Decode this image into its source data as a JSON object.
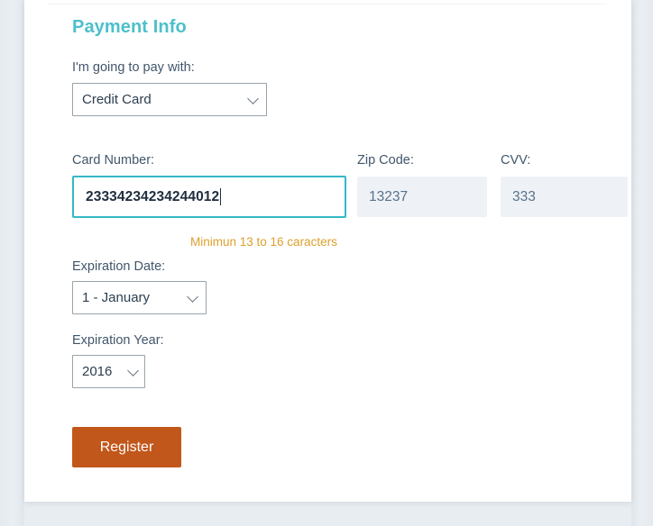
{
  "section": {
    "title": "Payment Info"
  },
  "pay_with": {
    "label": "I'm going to pay with:",
    "selected": "Credit Card",
    "options": [
      "Credit Card"
    ]
  },
  "card_number": {
    "label": "Card Number:",
    "value": "23334234234244012",
    "validation": "Minimun 13 to 16 caracters"
  },
  "zip_code": {
    "label": "Zip Code:",
    "value": "13237"
  },
  "cvv": {
    "label": "CVV:",
    "value": "333"
  },
  "expiration_date": {
    "label": "Expiration Date:",
    "selected": "1 - January",
    "options": [
      "1 - January"
    ]
  },
  "expiration_year": {
    "label": "Expiration Year:",
    "selected": "2016",
    "options": [
      "2016"
    ]
  },
  "actions": {
    "register_label": "Register"
  },
  "colors": {
    "heading_teal": "#4cc0ca",
    "focus_border_teal": "#35b8c6",
    "validation_orange": "#dda02e",
    "register_button": "#c2571b",
    "label_text": "#41566b",
    "disabled_field_bg": "#eef2f7",
    "page_background": "#e8edf1",
    "card_background": "#ffffff"
  },
  "icons": {
    "chevron_down": "chevron-down-icon"
  }
}
